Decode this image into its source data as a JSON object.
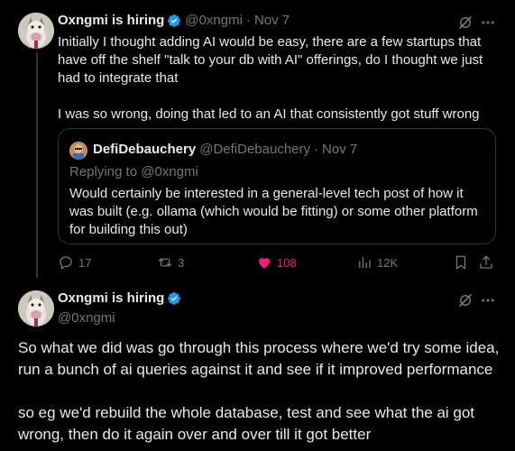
{
  "tweet1": {
    "author_name": "Oxngmi is hiring",
    "handle": "@0xngmi",
    "separator": "·",
    "date": "Nov 7",
    "text": "Initially I thought adding AI would be easy, there are a few startups that have off the shelf \"talk to your db with AI\" offerings, do I thought we just had to integrate that\n\nI was so wrong, doing that led to an AI that consistently got stuff wrong",
    "quote": {
      "author_name": "DefiDebauchery",
      "handle": "@DefiDebauchery",
      "separator": "·",
      "date": "Nov 7",
      "replying_prefix": "Replying to",
      "replying_to": "@0xngmi",
      "text": "Would certainly be interested in a general-level tech post of how it was built (e.g. ollama (which would be fitting) or some other platform for building this out)"
    },
    "actions": {
      "replies": "17",
      "reposts": "3",
      "likes": "108",
      "views": "12K"
    }
  },
  "tweet2": {
    "author_name": "Oxngmi is hiring",
    "handle": "@0xngmi",
    "text": "So what we did was go through this process where we'd try some idea, run a bunch of ai queries against it and see if it improved performance\n\nso eg we'd rebuild the whole database, test and see what the ai got wrong, then do it again over and over till it got better"
  },
  "colors": {
    "background": "#000000",
    "text": "#e7e9ea",
    "secondary": "#71767b",
    "verified": "#1d9bf0",
    "like": "#f91880",
    "border": "#2f3336"
  }
}
